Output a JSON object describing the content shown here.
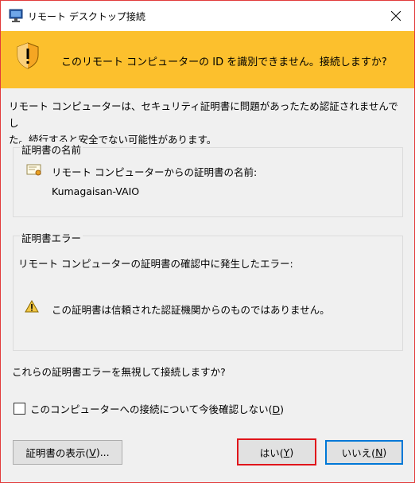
{
  "window": {
    "title": "リモート デスクトップ接続"
  },
  "banner": {
    "text": "このリモート コンピューターの ID を識別できません。接続しますか?"
  },
  "description": {
    "line1": "リモート コンピューターは、セキュリティ証明書に問題があったため認証されませんでし",
    "line2": "た。続行すると安全でない可能性があります。"
  },
  "cert_name_group": {
    "title": "証明書の名前",
    "label": "リモート コンピューターからの証明書の名前:",
    "value": "Kumagaisan-VAIO"
  },
  "cert_error_group": {
    "title": "証明書エラー",
    "label": "リモート コンピューターの証明書の確認中に発生したエラー:",
    "message": "この証明書は信頼された認証機関からのものではありません。"
  },
  "question": "これらの証明書エラーを無視して接続しますか?",
  "checkbox": {
    "label_prefix": "このコンピューターへの接続について今後確認しない(",
    "accesskey": "D",
    "label_suffix": ")",
    "checked": false
  },
  "buttons": {
    "show_cert": {
      "prefix": "証明書の表示(",
      "key": "V",
      "suffix": ")..."
    },
    "yes": {
      "prefix": "はい(",
      "key": "Y",
      "suffix": ")"
    },
    "no": {
      "prefix": "いいえ(",
      "key": "N",
      "suffix": ")"
    }
  },
  "colors": {
    "banner": "#fcc02d",
    "highlight_border": "#e0151b",
    "focus_border": "#0078d7"
  }
}
